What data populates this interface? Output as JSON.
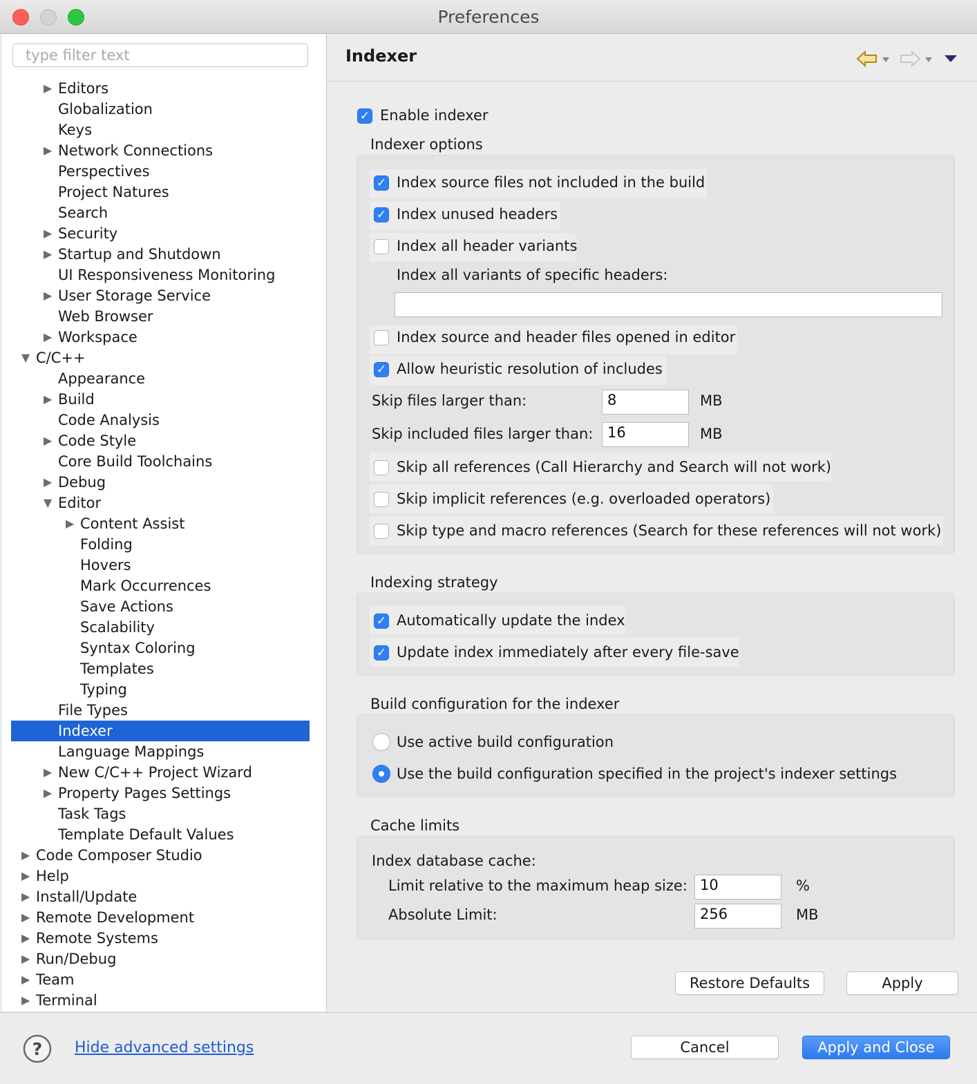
{
  "window": {
    "title": "Preferences"
  },
  "sidebar": {
    "filter_placeholder": "type filter text",
    "items": [
      {
        "label": "Editors",
        "level": 2,
        "twisty": "collapsed"
      },
      {
        "label": "Globalization",
        "level": 2,
        "twisty": "none"
      },
      {
        "label": "Keys",
        "level": 2,
        "twisty": "none"
      },
      {
        "label": "Network Connections",
        "level": 2,
        "twisty": "collapsed"
      },
      {
        "label": "Perspectives",
        "level": 2,
        "twisty": "none"
      },
      {
        "label": "Project Natures",
        "level": 2,
        "twisty": "none"
      },
      {
        "label": "Search",
        "level": 2,
        "twisty": "none"
      },
      {
        "label": "Security",
        "level": 2,
        "twisty": "collapsed"
      },
      {
        "label": "Startup and Shutdown",
        "level": 2,
        "twisty": "collapsed"
      },
      {
        "label": "UI Responsiveness Monitoring",
        "level": 2,
        "twisty": "none"
      },
      {
        "label": "User Storage Service",
        "level": 2,
        "twisty": "collapsed"
      },
      {
        "label": "Web Browser",
        "level": 2,
        "twisty": "none"
      },
      {
        "label": "Workspace",
        "level": 2,
        "twisty": "collapsed"
      },
      {
        "label": "C/C++",
        "level": 1,
        "twisty": "expanded"
      },
      {
        "label": "Appearance",
        "level": 2,
        "twisty": "none"
      },
      {
        "label": "Build",
        "level": 2,
        "twisty": "collapsed"
      },
      {
        "label": "Code Analysis",
        "level": 2,
        "twisty": "none"
      },
      {
        "label": "Code Style",
        "level": 2,
        "twisty": "collapsed"
      },
      {
        "label": "Core Build Toolchains",
        "level": 2,
        "twisty": "none"
      },
      {
        "label": "Debug",
        "level": 2,
        "twisty": "collapsed"
      },
      {
        "label": "Editor",
        "level": 2,
        "twisty": "expanded"
      },
      {
        "label": "Content Assist",
        "level": 3,
        "twisty": "collapsed"
      },
      {
        "label": "Folding",
        "level": 3,
        "twisty": "none"
      },
      {
        "label": "Hovers",
        "level": 3,
        "twisty": "none"
      },
      {
        "label": "Mark Occurrences",
        "level": 3,
        "twisty": "none"
      },
      {
        "label": "Save Actions",
        "level": 3,
        "twisty": "none"
      },
      {
        "label": "Scalability",
        "level": 3,
        "twisty": "none"
      },
      {
        "label": "Syntax Coloring",
        "level": 3,
        "twisty": "none"
      },
      {
        "label": "Templates",
        "level": 3,
        "twisty": "none"
      },
      {
        "label": "Typing",
        "level": 3,
        "twisty": "none"
      },
      {
        "label": "File Types",
        "level": 2,
        "twisty": "none"
      },
      {
        "label": "Indexer",
        "level": 2,
        "twisty": "none",
        "selected": true
      },
      {
        "label": "Language Mappings",
        "level": 2,
        "twisty": "none"
      },
      {
        "label": "New C/C++ Project Wizard",
        "level": 2,
        "twisty": "collapsed"
      },
      {
        "label": "Property Pages Settings",
        "level": 2,
        "twisty": "collapsed"
      },
      {
        "label": "Task Tags",
        "level": 2,
        "twisty": "none"
      },
      {
        "label": "Template Default Values",
        "level": 2,
        "twisty": "none"
      },
      {
        "label": "Code Composer Studio",
        "level": 1,
        "twisty": "collapsed"
      },
      {
        "label": "Help",
        "level": 1,
        "twisty": "collapsed"
      },
      {
        "label": "Install/Update",
        "level": 1,
        "twisty": "collapsed"
      },
      {
        "label": "Remote Development",
        "level": 1,
        "twisty": "collapsed"
      },
      {
        "label": "Remote Systems",
        "level": 1,
        "twisty": "collapsed"
      },
      {
        "label": "Run/Debug",
        "level": 1,
        "twisty": "collapsed"
      },
      {
        "label": "Team",
        "level": 1,
        "twisty": "collapsed"
      },
      {
        "label": "Terminal",
        "level": 1,
        "twisty": "collapsed"
      }
    ]
  },
  "page": {
    "title": "Indexer",
    "enable_indexer": {
      "label": "Enable indexer",
      "checked": true
    },
    "options": {
      "header": "Indexer options",
      "source_not_in_build": {
        "label": "Index source files not included in the build",
        "checked": true
      },
      "unused_headers": {
        "label": "Index unused headers",
        "checked": true
      },
      "all_header_variants": {
        "label": "Index all header variants",
        "checked": false
      },
      "specific_headers_label": "Index all variants of specific headers:",
      "specific_headers_value": "",
      "opened_in_editor": {
        "label": "Index source and header files opened in editor",
        "checked": false
      },
      "heuristic": {
        "label": "Allow heuristic resolution of includes",
        "checked": true
      },
      "skip_files_label": "Skip files larger than:",
      "skip_files_value": "8",
      "skip_files_unit": "MB",
      "skip_included_label": "Skip included files larger than:",
      "skip_included_value": "16",
      "skip_included_unit": "MB",
      "skip_all_refs": {
        "label": "Skip all references (Call Hierarchy and Search will not work)",
        "checked": false
      },
      "skip_implicit": {
        "label": "Skip implicit references (e.g. overloaded operators)",
        "checked": false
      },
      "skip_type_macro": {
        "label": "Skip type and macro references (Search for these references will not work)",
        "checked": false
      }
    },
    "strategy": {
      "header": "Indexing strategy",
      "auto_update": {
        "label": "Automatically update the index",
        "checked": true
      },
      "update_on_save": {
        "label": "Update index immediately after every file-save",
        "checked": true
      }
    },
    "build_config": {
      "header": "Build configuration for the indexer",
      "active": {
        "label": "Use active build configuration",
        "selected": false
      },
      "specified": {
        "label": "Use the build configuration specified in the project's indexer settings",
        "selected": true
      }
    },
    "cache": {
      "header": "Cache limits",
      "db_label": "Index database cache:",
      "relative_label": "Limit relative to the maximum heap size:",
      "relative_value": "10",
      "relative_unit": "%",
      "absolute_label": "Absolute Limit:",
      "absolute_value": "256",
      "absolute_unit": "MB"
    },
    "restore_defaults": "Restore Defaults",
    "apply": "Apply"
  },
  "footer": {
    "help_icon": "?",
    "advanced_link": "Hide advanced settings",
    "cancel": "Cancel",
    "apply_close": "Apply and Close"
  },
  "colors": {
    "selection": "#1e64d4",
    "accent": "#2f7ff5",
    "link": "#1f5cd1"
  },
  "icons": [
    "help-icon",
    "back-arrow-icon",
    "forward-arrow-icon",
    "view-menu-icon",
    "checkmark-icon"
  ]
}
